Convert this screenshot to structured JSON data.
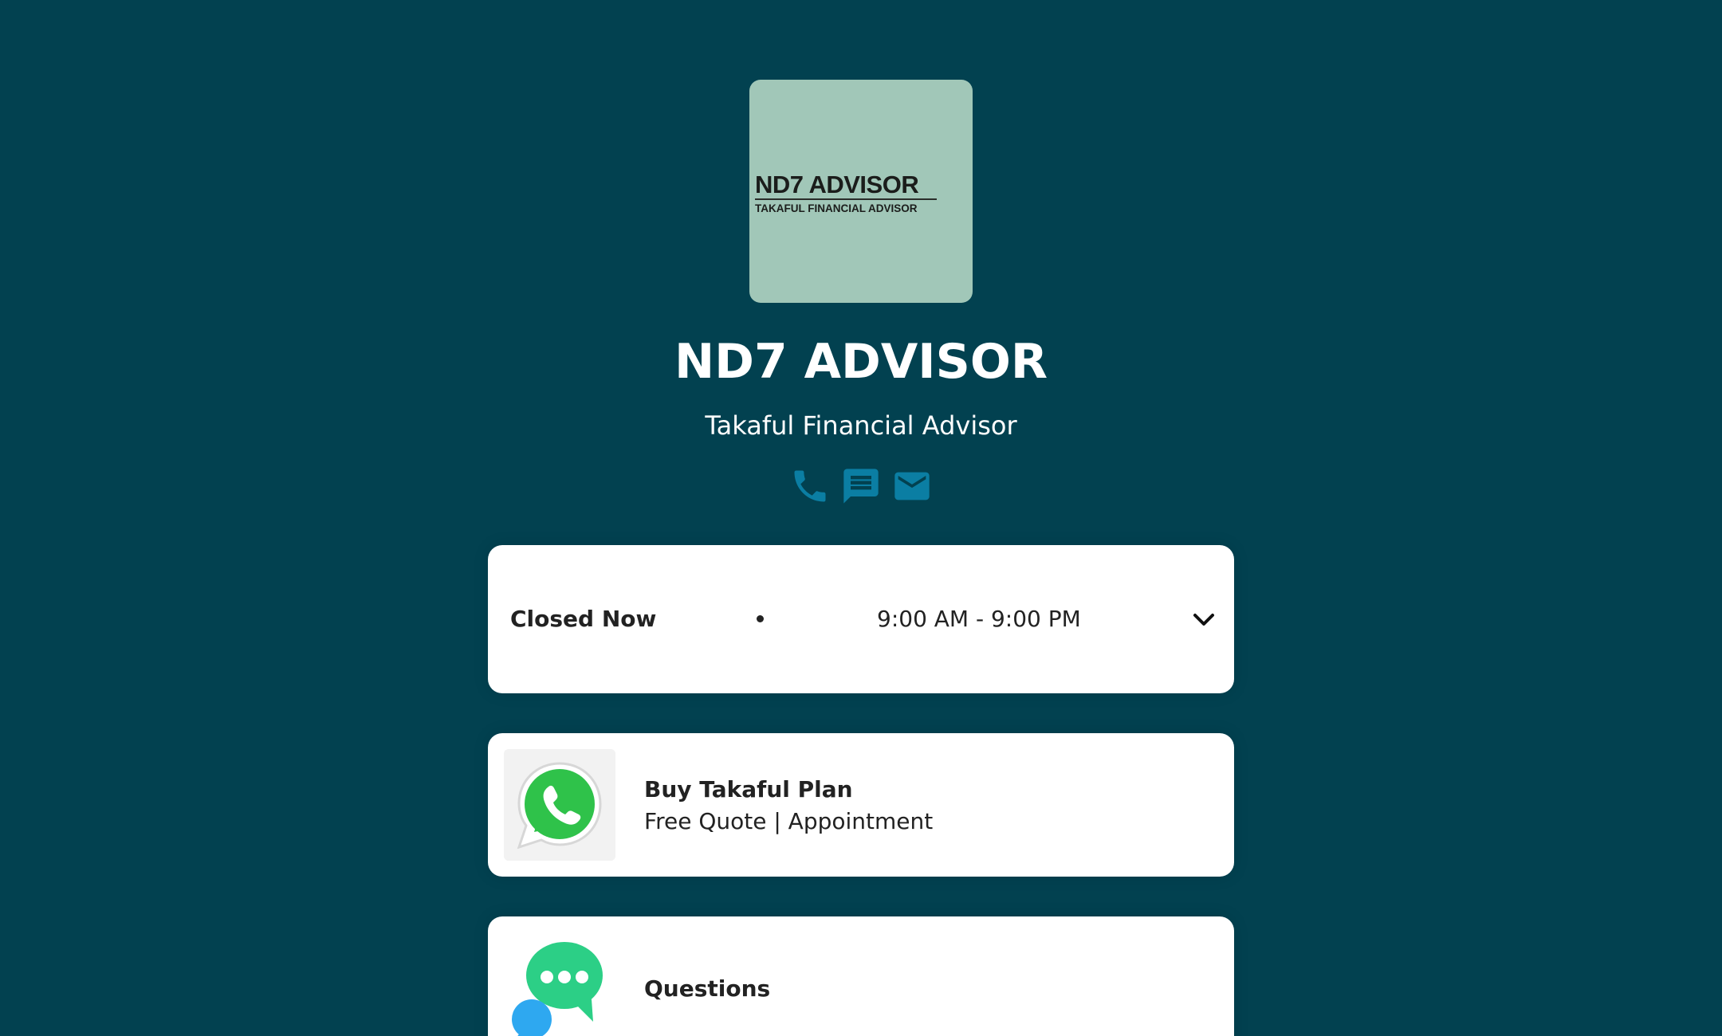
{
  "profile": {
    "logo_title": "ND7 ADVISOR",
    "logo_subtitle": "TAKAFUL FINANCIAL ADVISOR",
    "name": "ND7 ADVISOR",
    "tagline": "Takaful Financial Advisor"
  },
  "social": [
    {
      "icon": "phone-icon"
    },
    {
      "icon": "message-icon"
    },
    {
      "icon": "email-icon"
    }
  ],
  "hours": {
    "status": "Closed Now",
    "range": "9:00 AM - 9:00 PM",
    "expand_icon": "chevron-down-icon"
  },
  "links": [
    {
      "title": "Buy Takaful Plan",
      "subtitle": "Free Quote | Appointment",
      "icon": "whatsapp-icon"
    },
    {
      "title": "Questions",
      "icon": "chat-bubbles-icon"
    }
  ],
  "colors": {
    "background": "#024150",
    "logo_background": "#a1c7b8",
    "icon_accent": "#0b7ea3",
    "card": "#ffffff",
    "whatsapp_green": "#2fc24a",
    "chat_green": "#2ccf86",
    "chat_blue": "#2ea8f0"
  }
}
